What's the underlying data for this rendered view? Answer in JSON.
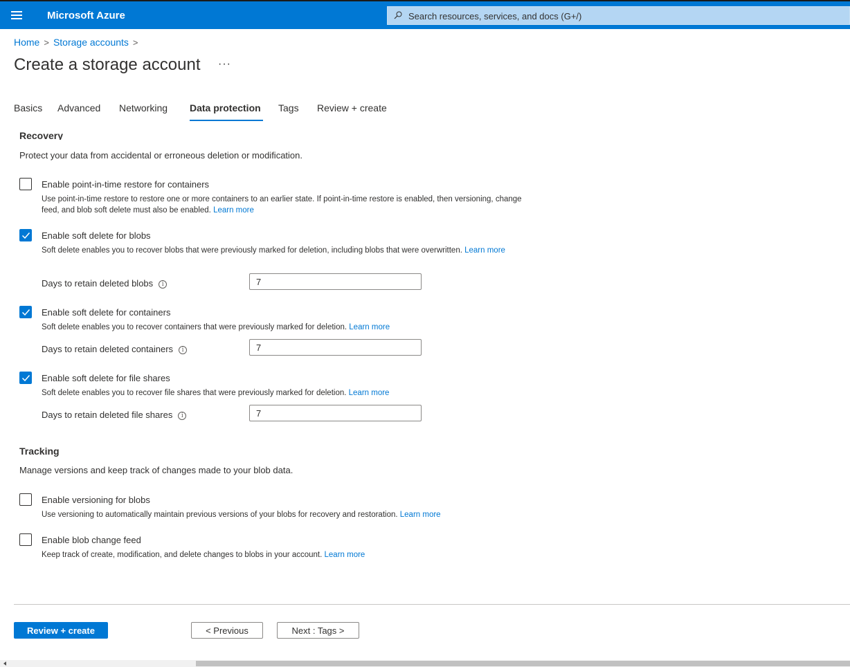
{
  "app": {
    "brand": "Microsoft Azure"
  },
  "search": {
    "placeholder": "Search resources, services, and docs (G+/)"
  },
  "breadcrumb": {
    "home": "Home",
    "storage": "Storage accounts",
    "sep": ">"
  },
  "page": {
    "title": "Create a storage account",
    "more": "···"
  },
  "tabs": [
    {
      "label": "Basics"
    },
    {
      "label": "Advanced"
    },
    {
      "label": "Networking"
    },
    {
      "label": "Data protection",
      "active": true
    },
    {
      "label": "Tags"
    },
    {
      "label": "Review + create"
    }
  ],
  "recovery": {
    "heading": "Recovery",
    "description": "Protect your data from accidental or erroneous deletion or modification.",
    "pitr": {
      "label": "Enable point-in-time restore for containers",
      "checked": false,
      "desc": "Use point-in-time restore to restore one or more containers to an earlier state. If point-in-time restore is enabled, then versioning, change feed, and blob soft delete must also be enabled.",
      "link": "Learn more"
    },
    "blobs": {
      "label": "Enable soft delete for blobs",
      "checked": true,
      "desc": "Soft delete enables you to recover blobs that were previously marked for deletion, including blobs that were overwritten.",
      "link": "Learn more",
      "days_label": "Days to retain deleted blobs",
      "days_value": "7"
    },
    "containers": {
      "label": "Enable soft delete for containers",
      "checked": true,
      "desc": "Soft delete enables you to recover containers that were previously marked for deletion.",
      "link": "Learn more",
      "days_label": "Days to retain deleted containers",
      "days_value": "7"
    },
    "fileshares": {
      "label": "Enable soft delete for file shares",
      "checked": true,
      "desc": "Soft delete enables you to recover file shares that were previously marked for deletion.",
      "link": "Learn more",
      "days_label": "Days to retain deleted file shares",
      "days_value": "7"
    }
  },
  "tracking": {
    "heading": "Tracking",
    "description": "Manage versions and keep track of changes made to your blob data.",
    "versioning": {
      "label": "Enable versioning for blobs",
      "checked": false,
      "desc": "Use versioning to automatically maintain previous versions of your blobs for recovery and restoration.",
      "link": "Learn more"
    },
    "changefeed": {
      "label": "Enable blob change feed",
      "checked": false,
      "desc": "Keep track of create, modification, and delete changes to blobs in your account.",
      "link": "Learn more"
    }
  },
  "footer": {
    "review": "Review + create",
    "previous": "< Previous",
    "next": "Next : Tags >"
  },
  "colors": {
    "accent": "#0078d4",
    "text": "#323130"
  },
  "icons": [
    "hamburger-icon",
    "search-icon",
    "more-icon",
    "chevron-right-icon",
    "checkmark-icon",
    "info-icon"
  ]
}
